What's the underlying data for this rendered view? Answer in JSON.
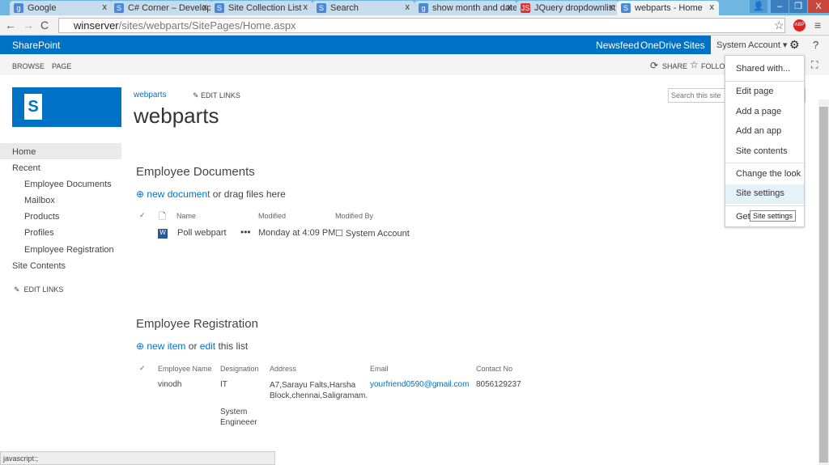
{
  "browser": {
    "tabs": [
      {
        "title": "Google",
        "icon": "google-icon"
      },
      {
        "title": "C# Corner – Develope",
        "icon": "csharpcorner-icon"
      },
      {
        "title": "Site Collection List",
        "icon": "sharepoint-icon"
      },
      {
        "title": "Search",
        "icon": "sharepoint-icon"
      },
      {
        "title": "show month and date",
        "icon": "google-icon"
      },
      {
        "title": "JQuery dropdownlist",
        "icon": "js-icon"
      },
      {
        "title": "webparts - Home",
        "icon": "sharepoint-icon"
      }
    ],
    "url_host": "winserver",
    "url_path": "/sites/webparts/SitePages/Home.aspx",
    "status": "javascript:;",
    "abp": "ABP"
  },
  "suite": {
    "brand": "SharePoint",
    "links": [
      "Newsfeed",
      "OneDrive",
      "Sites"
    ],
    "user": "System Account ▾"
  },
  "ribbon": {
    "tabs": [
      "BROWSE",
      "PAGE"
    ],
    "share": "SHARE",
    "follow": "FOLLOW"
  },
  "header": {
    "breadcrumb": "webparts",
    "edit_links": "EDIT LINKS",
    "title": "webparts",
    "search_placeholder": "Search this site"
  },
  "quicklaunch": {
    "items": [
      "Home",
      "Recent",
      "Employee Documents",
      "Mailbox",
      "Products",
      "Profiles",
      "Employee Registration",
      "Site Contents"
    ],
    "edit_links": "EDIT LINKS"
  },
  "docs": {
    "title": "Employee Documents",
    "new": "new document",
    "or": " or drag files here",
    "columns": [
      "Name",
      "Modified",
      "Modified By"
    ],
    "rows": [
      {
        "name": "Poll webpart",
        "modified": "Monday at 4:09 PM",
        "by": "System Account"
      }
    ]
  },
  "reg": {
    "title": "Employee Registration",
    "new": "new item",
    "or": " or ",
    "edit": "edit",
    "rest": " this list",
    "columns": [
      "Employee Name",
      "Designation",
      "Address",
      "Email",
      "Contact No"
    ],
    "rows": [
      {
        "name": "vinodh",
        "designation": "IT",
        "address": "A7,Sarayu Falts,Harsha Block,chennai,Saligramam.",
        "email": "yourfriend0590@gmail.com",
        "contact": "8056129237"
      },
      {
        "designation": "System Engineeer"
      }
    ]
  },
  "menu": {
    "items": [
      "Shared with...",
      "Edit page",
      "Add a page",
      "Add an app",
      "Site contents",
      "Change the look",
      "Site settings",
      "Get"
    ],
    "tooltip": "Site settings"
  },
  "colors": {
    "brand": "#0072c6",
    "highlight": "#e6f2fa"
  }
}
